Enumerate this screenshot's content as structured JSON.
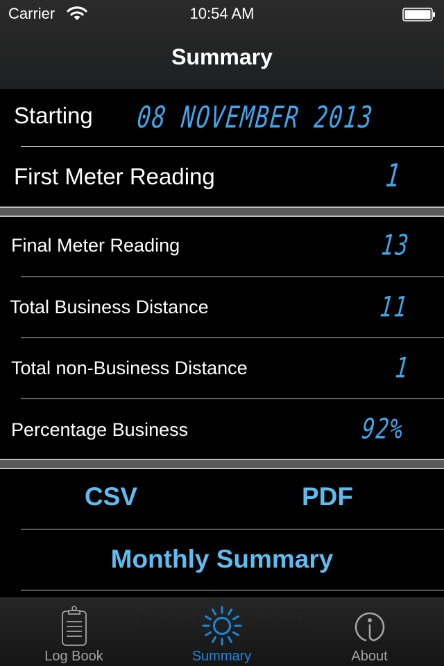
{
  "status_bar": {
    "carrier": "Carrier",
    "time": "10:54 AM",
    "wifi_icon": "wifi-icon",
    "battery_icon": "battery-icon"
  },
  "nav": {
    "title": "Summary"
  },
  "colors": {
    "accent_lcd": "#3ea6ec",
    "button_text": "#5fbcf1",
    "tab_active": "#1b86e0",
    "tab_inactive": "#a3a3a3",
    "section_gap": "#595959"
  },
  "start_section": {
    "starting_label": "Starting",
    "starting_value": "08 NOVEMBER 2013",
    "first_meter_label": "First Meter Reading",
    "first_meter_value": "1"
  },
  "summary_section": {
    "rows": [
      {
        "label": "Final Meter Reading",
        "value": "13"
      },
      {
        "label": "Total Business Distance",
        "value": "11"
      },
      {
        "label": "Total non-Business Distance",
        "value": "1"
      },
      {
        "label": "Percentage Business",
        "value": "92%"
      }
    ]
  },
  "actions": {
    "csv": "CSV",
    "pdf": "PDF",
    "monthly_summary": "Monthly Summary",
    "hidden_behind_tabbar": "Delete Entries"
  },
  "tabbar": {
    "tabs": [
      {
        "label": "Log Book",
        "icon": "clipboard-icon",
        "active": false
      },
      {
        "label": "Summary",
        "icon": "sun-icon",
        "active": true
      },
      {
        "label": "About",
        "icon": "info-icon",
        "active": false
      }
    ]
  }
}
